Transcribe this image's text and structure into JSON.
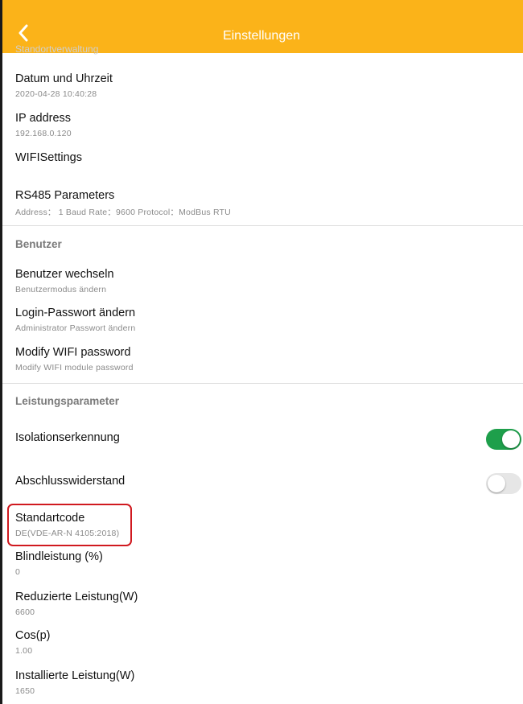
{
  "header": {
    "title": "Einstellungen"
  },
  "partial_item": {
    "label": "Standortverwaltung"
  },
  "items_top": [
    {
      "title": "Datum und Uhrzeit",
      "subtitle": "2020-04-28 10:40:28"
    },
    {
      "title": "IP address",
      "subtitle": "192.168.0.120"
    },
    {
      "title": "WIFISettings",
      "subtitle": ""
    },
    {
      "title": "RS485 Parameters",
      "subtitle": "Address： 1   Baud Rate：9600   Protocol：ModBus RTU"
    }
  ],
  "section_user": {
    "title": "Benutzer"
  },
  "items_user": [
    {
      "title": "Benutzer wechseln",
      "subtitle": "Benutzermodus ändern"
    },
    {
      "title": "Login-Passwort ändern",
      "subtitle": "Administrator Passwort ändern"
    },
    {
      "title": "Modify WIFI password",
      "subtitle": "Modify WIFI module password"
    }
  ],
  "section_power": {
    "title": "Leistungsparameter"
  },
  "toggles": [
    {
      "title": "Isolationserkennung",
      "state": "on"
    },
    {
      "title": "Abschlusswiderstand",
      "state": "off"
    }
  ],
  "items_power": [
    {
      "title": "Standartcode",
      "subtitle": "DE(VDE-AR-N 4105:2018)"
    },
    {
      "title": "Blindleistung (%)",
      "subtitle": "0"
    },
    {
      "title": "Reduzierte Leistung(W)",
      "subtitle": "6600"
    },
    {
      "title": "Cos(p)",
      "subtitle": "1.00"
    },
    {
      "title": "Installierte Leistung(W)",
      "subtitle": "1650"
    }
  ],
  "colors": {
    "header": "#fbb319",
    "toggle_on": "#1e9f4b",
    "highlight": "#d0191f"
  }
}
